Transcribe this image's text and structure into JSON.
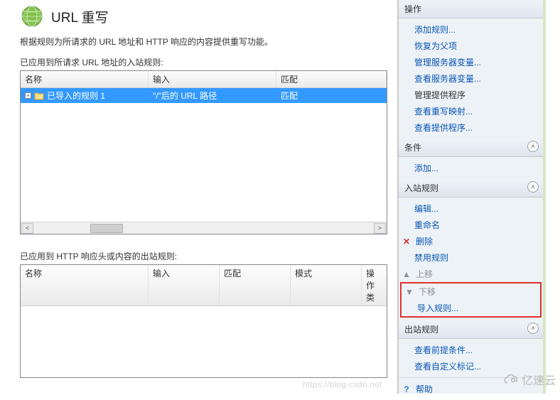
{
  "page": {
    "title": "URL 重写",
    "description": "根据规则为所请求的 URL 地址和 HTTP 响应的内容提供重写功能。",
    "inbound_section_label": "已应用到所请求 URL 地址的入站规则:",
    "outbound_section_label": "已应用到 HTTP 响应头或内容的出站规则:"
  },
  "inbound_table": {
    "columns": {
      "name": "名称",
      "input": "输入",
      "match": "匹配"
    },
    "rows": [
      {
        "name": "已导入的规则 1",
        "input": "\"/\"后的 URL 路径",
        "match": "匹配"
      }
    ]
  },
  "outbound_table": {
    "columns": {
      "name": "名称",
      "input": "输入",
      "match": "匹配",
      "pattern": "模式",
      "action": "操作类"
    }
  },
  "actions": {
    "header": "操作",
    "add_rule": "添加规则...",
    "restore_parent": "恢复为父项",
    "manage_server_vars": "管理服务器变量...",
    "view_server_vars": "查看服务器变量...",
    "manage_providers": "管理提供程序",
    "view_rewrite_maps": "查看重写映射...",
    "view_providers": "查看提供程序...",
    "conditions_header": "条件",
    "add": "添加...",
    "inbound_header": "入站规则",
    "edit": "编辑...",
    "rename": "重命名",
    "delete": "删除",
    "disable_rule": "禁用规则",
    "move_up": "上移",
    "move_down": "下移",
    "import_rules": "导入规则...",
    "outbound_header": "出站规则",
    "view_preconditions": "查看前提条件...",
    "view_custom_tags": "查看自定义标记...",
    "help": "帮助"
  },
  "watermark": {
    "text": "亿速云",
    "url": "https://blog.csdn.net"
  }
}
